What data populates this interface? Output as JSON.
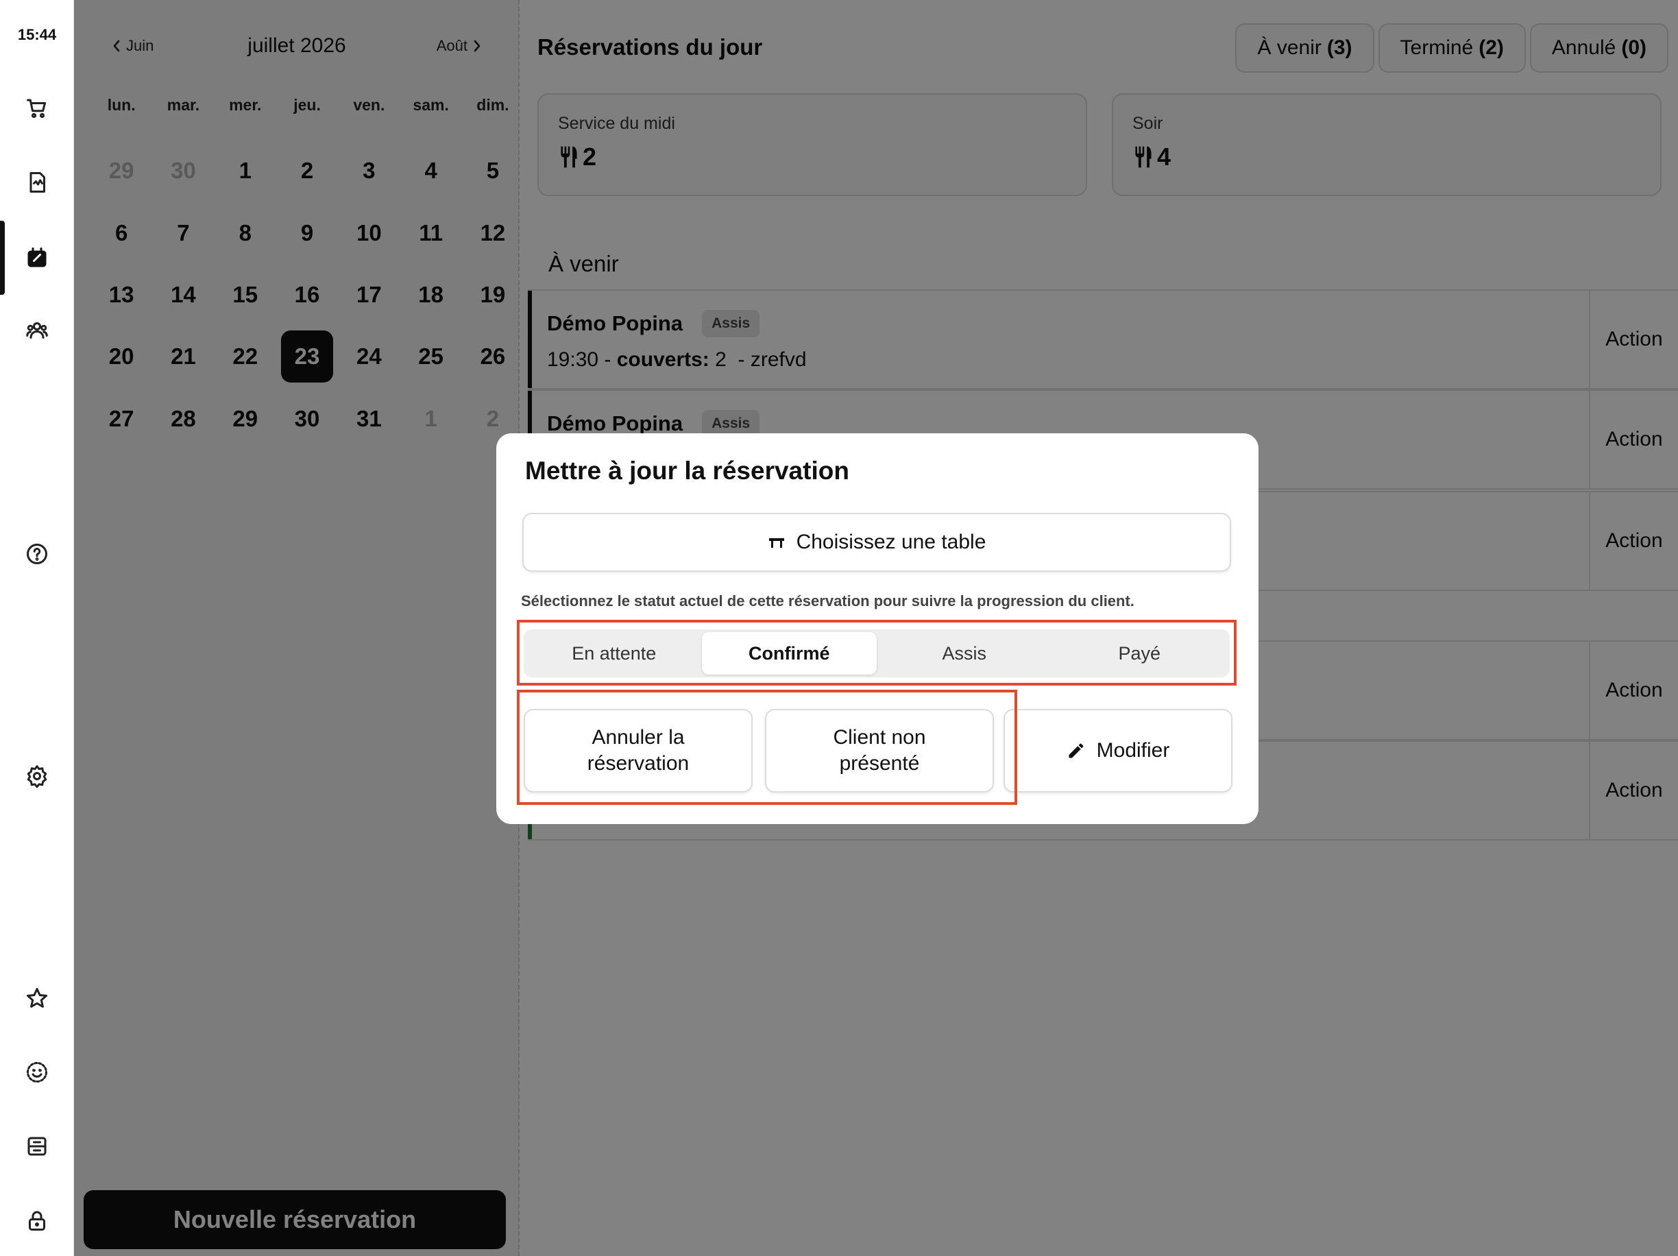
{
  "status_bar": {
    "time": "15:44"
  },
  "rail": {
    "icons": [
      "cart-icon",
      "receipt-icon",
      "calendar-icon",
      "users-icon",
      "help-icon",
      "settings-icon",
      "star-icon",
      "smiley-icon",
      "archive-icon",
      "lock-icon"
    ],
    "active": "calendar-icon"
  },
  "calendar": {
    "prev_label": "Juin",
    "next_label": "Août",
    "month_title": "juillet 2026",
    "weekdays": [
      "lun.",
      "mar.",
      "mer.",
      "jeu.",
      "ven.",
      "sam.",
      "dim."
    ],
    "days": [
      {
        "d": "29",
        "muted": true
      },
      {
        "d": "30",
        "muted": true
      },
      {
        "d": "1"
      },
      {
        "d": "2"
      },
      {
        "d": "3"
      },
      {
        "d": "4"
      },
      {
        "d": "5"
      },
      {
        "d": "6"
      },
      {
        "d": "7"
      },
      {
        "d": "8"
      },
      {
        "d": "9"
      },
      {
        "d": "10"
      },
      {
        "d": "11"
      },
      {
        "d": "12"
      },
      {
        "d": "13"
      },
      {
        "d": "14"
      },
      {
        "d": "15"
      },
      {
        "d": "16"
      },
      {
        "d": "17"
      },
      {
        "d": "18"
      },
      {
        "d": "19"
      },
      {
        "d": "20"
      },
      {
        "d": "21"
      },
      {
        "d": "22"
      },
      {
        "d": "23",
        "selected": true
      },
      {
        "d": "24"
      },
      {
        "d": "25"
      },
      {
        "d": "26"
      },
      {
        "d": "27"
      },
      {
        "d": "28"
      },
      {
        "d": "29"
      },
      {
        "d": "30"
      },
      {
        "d": "31"
      },
      {
        "d": "1",
        "muted": true
      },
      {
        "d": "2",
        "muted": true
      }
    ],
    "new_button": "Nouvelle réservation"
  },
  "main": {
    "title": "Réservations du jour",
    "filters": [
      {
        "label": "À venir",
        "count": "(3)"
      },
      {
        "label": "Terminé",
        "count": "(2)"
      },
      {
        "label": "Annulé",
        "count": "(0)"
      }
    ],
    "services": [
      {
        "label": "Service du midi",
        "value": "2"
      },
      {
        "label": "Soir",
        "value": "4"
      }
    ],
    "section_upcoming": "À venir",
    "reservations": [
      {
        "name": "Démo Popina",
        "badge": "Assis",
        "time": "19:30",
        "couverts_label": "couverts:",
        "couverts": "2",
        "note": "zrefvd",
        "action": "Action"
      },
      {
        "name": "Démo Popina",
        "badge": "Assis",
        "action": "Action"
      },
      {
        "action": "Action"
      },
      {
        "action": "Action"
      },
      {
        "action": "Action"
      }
    ]
  },
  "modal": {
    "title": "Mettre à jour la réservation",
    "choose_table": "Choisissez une table",
    "hint": "Sélectionnez le statut actuel de cette réservation pour suivre la progression du client.",
    "statuses": [
      "En attente",
      "Confirmé",
      "Assis",
      "Payé"
    ],
    "active_status": "Confirmé",
    "cancel_button": "Annuler la réservation",
    "noshow_button": "Client non présenté",
    "edit_button": "Modifier",
    "highlight_color": "#e04a2f"
  }
}
